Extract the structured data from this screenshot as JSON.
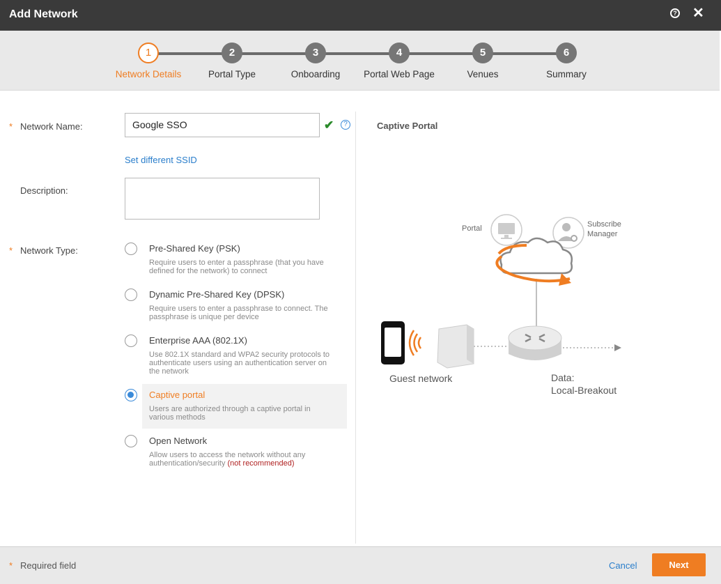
{
  "header": {
    "title": "Add Network"
  },
  "steps": [
    {
      "num": "1",
      "label": "Network Details"
    },
    {
      "num": "2",
      "label": "Portal Type"
    },
    {
      "num": "3",
      "label": "Onboarding"
    },
    {
      "num": "4",
      "label": "Portal Web Page"
    },
    {
      "num": "5",
      "label": "Venues"
    },
    {
      "num": "6",
      "label": "Summary"
    }
  ],
  "form": {
    "required_star": "*",
    "network_name_label": "Network Name:",
    "network_name_value": "Google SSO",
    "set_ssid_link": "Set different SSID",
    "description_label": "Description:",
    "network_type_label": "Network Type:",
    "options": [
      {
        "title": "Pre-Shared Key (PSK)",
        "desc": "Require users to enter a passphrase (that you have defined for the network) to connect",
        "selected": false
      },
      {
        "title": "Dynamic Pre-Shared Key (DPSK)",
        "desc": "Require users to enter a passphrase to connect. The passphrase is unique per device",
        "selected": false
      },
      {
        "title": "Enterprise AAA (802.1X)",
        "desc": "Use 802.1X standard and WPA2 security protocols to authenticate users using an authentication server on the network",
        "selected": false
      },
      {
        "title": "Captive portal",
        "desc": "Users are authorized through a captive portal in various methods",
        "selected": true
      },
      {
        "title": "Open Network",
        "desc": "Allow users to access the network without any authentication/security",
        "desc_extra": "(not recommended)",
        "selected": false
      }
    ]
  },
  "illustration": {
    "title": "Captive Portal",
    "portal_label": "Portal",
    "subscribe_label_1": "Subscribe",
    "subscribe_label_2": "Manager",
    "guest_label": "Guest network",
    "data_label_1": "Data:",
    "data_label_2": "Local-Breakout"
  },
  "footer": {
    "required_star": "*",
    "required_text": "Required field",
    "cancel": "Cancel",
    "next": "Next"
  },
  "colors": {
    "accent": "#ef7d22",
    "link": "#2a7ecb",
    "header_bg": "#3a3a3a"
  }
}
